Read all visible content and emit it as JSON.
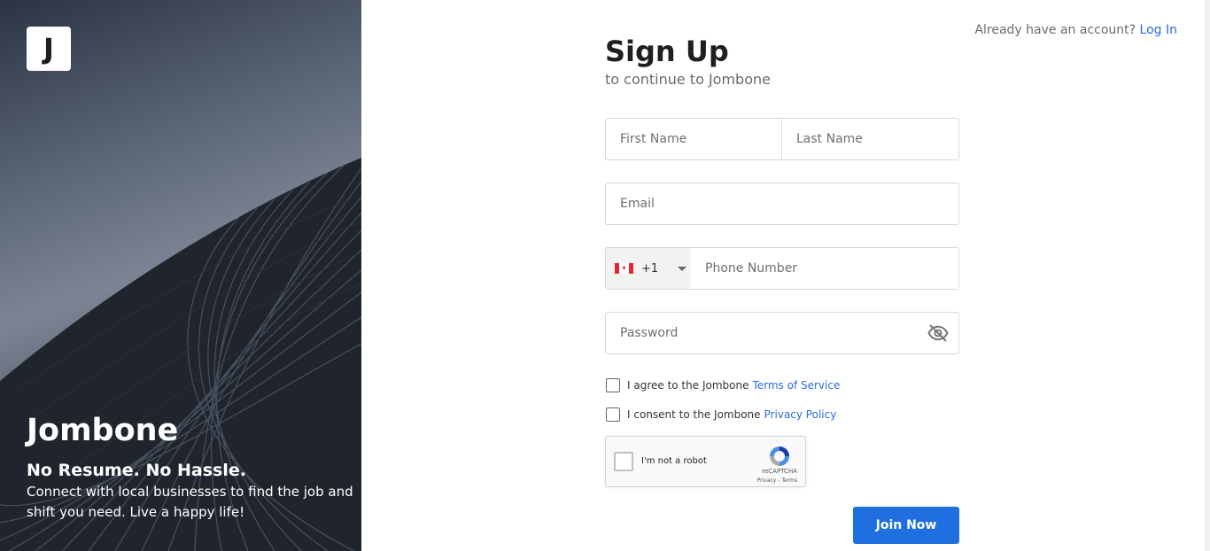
{
  "hero": {
    "logo_letter": "J",
    "brand": "Jombone",
    "tagline": "No Resume. No Hassle.",
    "description": "Connect with local businesses to find the job and shift you need. Live a happy life!"
  },
  "top": {
    "prompt": "Already have an account?",
    "login_label": "Log In"
  },
  "form": {
    "title": "Sign Up",
    "subtitle": "to continue to Jombone",
    "first_name_placeholder": "First Name",
    "last_name_placeholder": "Last Name",
    "email_placeholder": "Email",
    "phone": {
      "country_code": "+1",
      "country_flag": "canada-flag",
      "placeholder": "Phone Number"
    },
    "password_placeholder": "Password",
    "terms": {
      "prefix": "I agree to the Jombone",
      "link": "Terms of Service"
    },
    "privacy": {
      "prefix": "I consent to the Jombone",
      "link": "Privacy Policy"
    },
    "captcha": {
      "label": "I'm not a robot",
      "brand": "reCAPTCHA",
      "terms": "Privacy - Terms"
    },
    "submit_label": "Join Now"
  },
  "colors": {
    "accent": "#1f6fe0",
    "link": "#2b6bd6"
  }
}
